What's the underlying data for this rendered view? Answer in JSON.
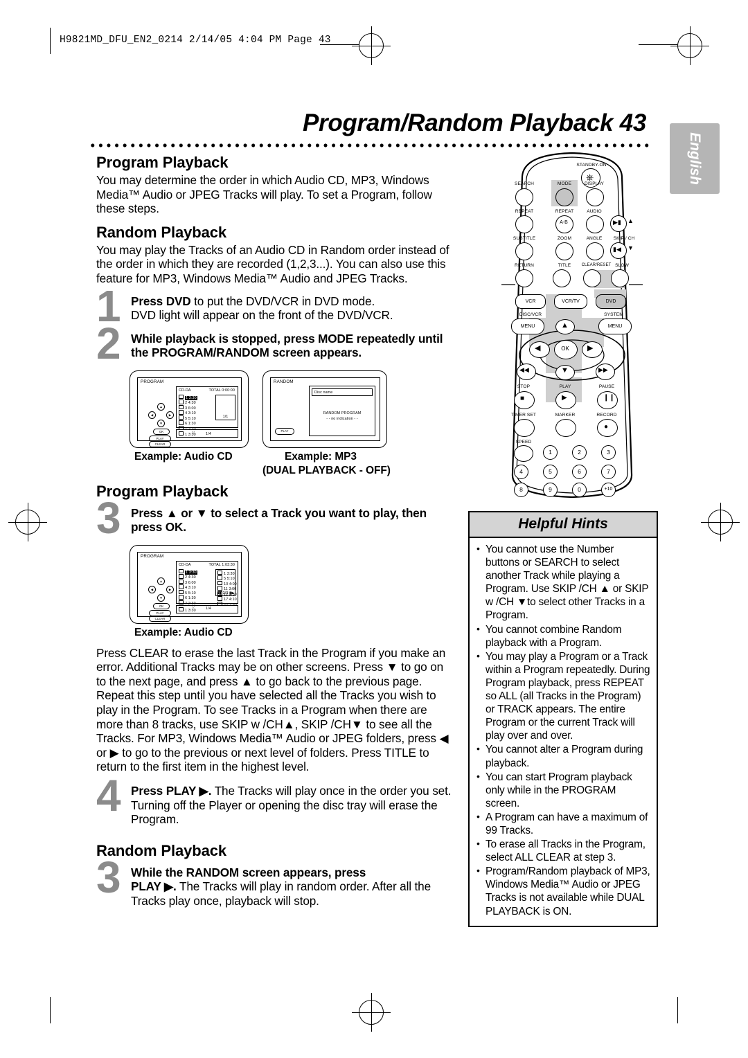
{
  "header": {
    "filestamp": "H9821MD_DFU_EN2_0214   2/14/05   4:04 PM   Page 43"
  },
  "title": "Program/Random Playback  43",
  "side_tab": "English",
  "sections": {
    "program_playback_1": {
      "heading": "Program Playback",
      "body": "You may determine the order in which Audio CD, MP3, Windows Media™ Audio or JPEG Tracks will play. To set a Program, follow these steps."
    },
    "random_playback_1": {
      "heading": "Random Playback",
      "body": "You may play the Tracks of an Audio CD in Random order instead of the order in which they are recorded (1,2,3...). You can also use this feature for MP3, Windows Media™ Audio and JPEG Tracks."
    },
    "program_playback_2": {
      "heading": "Program Playback"
    },
    "random_playback_2": {
      "heading": "Random Playback"
    }
  },
  "steps": {
    "one": {
      "number": "1",
      "line1_bold": "Press DVD",
      "line1_rest": " to put the DVD/VCR in DVD mode.",
      "line2": "DVD light will appear on the front of the DVD/VCR."
    },
    "two": {
      "number": "2",
      "text": "While playback is stopped, press MODE repeatedly until the PROGRAM/RANDOM screen appears."
    },
    "three": {
      "number": "3",
      "text": "Press ▲ or ▼ to select a Track you want to play, then press OK."
    },
    "three_paragraph": "Press CLEAR to erase the last Track in the Program if you make an error. Additional Tracks may be on other screens. Press ▼ to go on to the next page, and press ▲ to go back to the previous page. Repeat this step until you have selected all the Tracks you wish to play in the Program. To see Tracks in a Program when there are more than 8 tracks, use SKIP w /CH▲, SKIP    /CH▼ to see all the Tracks. For MP3, Windows Media™ Audio or JPEG folders, press ◀ or ▶ to go to the previous or next level of folders. Press TITLE to return to the first item in the highest level.",
    "four": {
      "number": "4",
      "bold": "Press PLAY ▶.",
      "rest": " The Tracks will play once in the order you set. Turning off the Player or opening the disc tray will erase the Program."
    },
    "random_three": {
      "number": "3",
      "bold1": "While the RANDOM screen appears, press",
      "bold2": "PLAY ▶.",
      "rest": " The Tracks will play in random order. After all the Tracks play once, playback will stop."
    }
  },
  "figures": {
    "audio_cd_1": {
      "caption": "Example: Audio CD",
      "osd_title": "PROGRAM",
      "disc_type": "CD-DA",
      "total_label": "TOTAL 0:00:00",
      "tracks": [
        "1  3:30",
        "2  4:30",
        "3  6:00",
        "4  3:10",
        "5  5:10",
        "6  1:30",
        "7  2:30"
      ],
      "page_left": "1/4",
      "page_right": "1/1",
      "status_bar": "1  3:30",
      "keys": [
        "PLAY",
        "CLEAR"
      ]
    },
    "mp3": {
      "caption": "Example: MP3",
      "caption2": "(DUAL PLAYBACK - OFF)",
      "osd_title": "RANDOM",
      "disc_name": "Disc name",
      "center_line1": "RANDOM  PROGRAM",
      "center_line2": "- - no  indication - -",
      "key": "PLAY"
    },
    "audio_cd_2": {
      "caption": "Example: Audio CD",
      "osd_title": "PROGRAM",
      "disc_type": "CD-DA",
      "total_label": "TOTAL 1:03:30",
      "tracks_left": [
        "1  3:30",
        "2  4:30",
        "3  6:00",
        "4  3:10",
        "5  5:10",
        "6  1:30",
        "7  2:30"
      ],
      "tracks_right": [
        "1  3:30",
        "5  5:10",
        "10 4:00",
        "11 3:00",
        "12 3:30",
        "17 4:10",
        "22 2:50"
      ],
      "page_left": "1/4",
      "page_right": "2/3",
      "status_bar": "1  3:30",
      "keys": [
        "PLAY",
        "CLEAR"
      ]
    }
  },
  "helpful_hints": {
    "heading": "Helpful Hints",
    "items": [
      "You cannot use the Number buttons or SEARCH to select another Track while playing a Program. Use SKIP    /CH ▲ or SKIP w /CH ▼to select other Tracks in a Program.",
      "You cannot combine Random playback with a Program.",
      "You may play a Program or a Track within a Program repeatedly. During Program playback, press REPEAT so ALL (all Tracks in the Program) or TRACK appears. The entire Program or the current Track will play over and over.",
      "You cannot alter a Program during playback.",
      "You can start Program playback only while in the PROGRAM screen.",
      "A Program can have a maximum of 99 Tracks.",
      "To erase all Tracks in the Program, select ALL CLEAR at step 3.",
      "Program/Random playback of MP3, Windows Media™ Audio or JPEG Tracks is not available while DUAL PLAYBACK is ON."
    ]
  },
  "remote": {
    "standby_label": "STANDBY-ON",
    "labels_row1": [
      "SEARCH",
      "MODE",
      "DISPLAY"
    ],
    "labels_row2": [
      "REPEAT",
      "REPEAT",
      "AUDIO"
    ],
    "repeat_ab": "A-B",
    "skip_ch": "SKIP / CH",
    "labels_row3": [
      "SUBTITLE",
      "ZOOM",
      "ANGLE"
    ],
    "labels_row4": [
      "RETURN",
      "TITLE",
      "CLEAR/RESET",
      "SLOW"
    ],
    "mode_buttons": [
      "VCR",
      "VCR/TV",
      "DVD"
    ],
    "menu_left_label": "DISC/VCR",
    "menu_right_label": "SYSTEM",
    "menu_text": "MENU",
    "ok_text": "OK",
    "transport_labels": [
      "STOP",
      "PLAY",
      "PAUSE"
    ],
    "bottom_labels": [
      "TIMER SET",
      "MARKER",
      "RECORD"
    ],
    "speed_label": "SPEED",
    "numbers": [
      "1",
      "2",
      "3",
      "4",
      "5",
      "6",
      "7",
      "8",
      "9",
      "0",
      "+10"
    ],
    "highlight_color": "#cfcfcf"
  }
}
